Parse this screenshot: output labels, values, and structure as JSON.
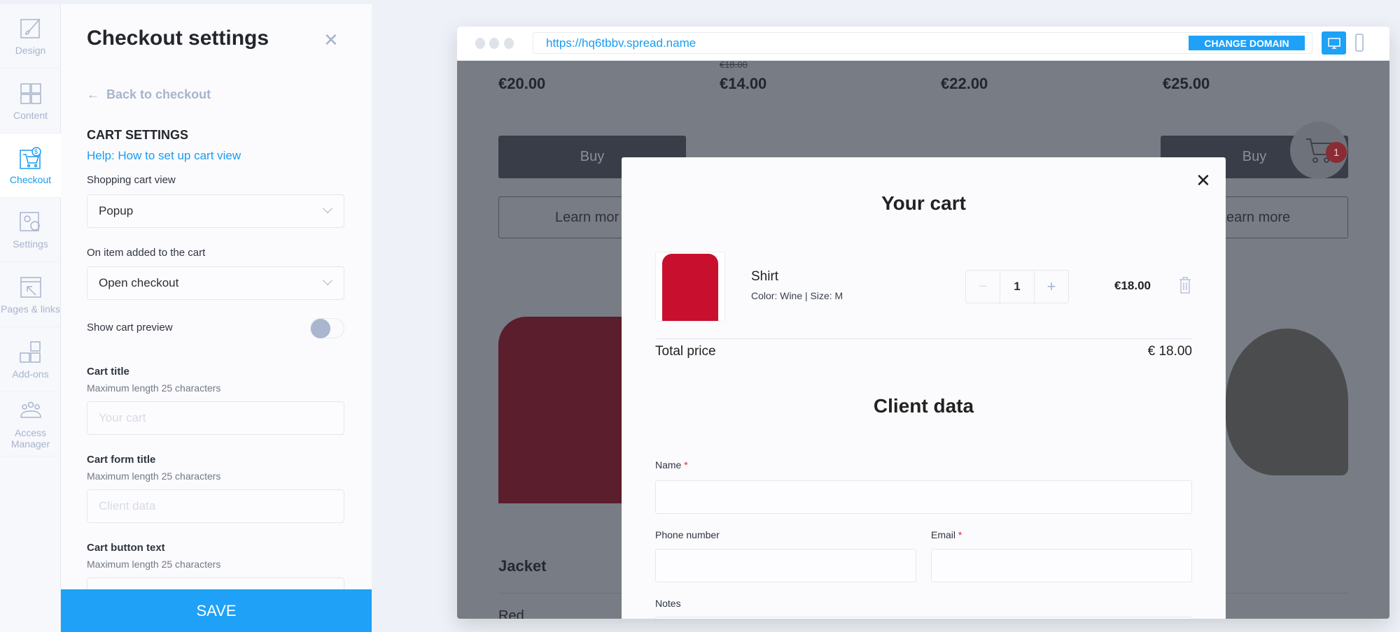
{
  "rail": [
    {
      "label": "Design",
      "icon": "brush-icon"
    },
    {
      "label": "Content",
      "icon": "grid-icon"
    },
    {
      "label": "Checkout",
      "icon": "cart-dollar-icon",
      "active": true
    },
    {
      "label": "Settings",
      "icon": "gears-icon"
    },
    {
      "label": "Pages & links",
      "icon": "pages-icon"
    },
    {
      "label": "Add-ons",
      "icon": "addons-icon"
    },
    {
      "label": "Access Manager",
      "icon": "users-icon"
    }
  ],
  "panel": {
    "title": "Checkout settings",
    "back": "Back to checkout",
    "section": "CART SETTINGS",
    "help": "Help: How to set up cart view",
    "cart_view_label": "Shopping cart view",
    "cart_view_value": "Popup",
    "on_add_label": "On item added to the cart",
    "on_add_value": "Open checkout",
    "preview_label": "Show cart preview",
    "preview_on": false,
    "cart_title_label": "Cart title",
    "cart_title_hint": "Maximum length 25 characters",
    "cart_title_placeholder": "Your cart",
    "form_title_label": "Cart form title",
    "form_title_hint": "Maximum length 25 characters",
    "form_title_placeholder": "Client data",
    "button_text_label": "Cart button text",
    "button_text_hint": "Maximum length 25 characters",
    "save": "SAVE"
  },
  "browser": {
    "url": "https://hq6tbbv.spread.name",
    "change_domain": "CHANGE DOMAIN"
  },
  "site": {
    "prices": [
      "€20.00",
      "€14.00",
      "€22.00",
      "€25.00"
    ],
    "old_price": "€18.00",
    "buy": "Buy",
    "learn": "Learn more",
    "learn_partial_left": "Learn mor",
    "learn_partial_right": "earn more",
    "product": "Jacket",
    "color": "Red",
    "cart_count": "1"
  },
  "modal": {
    "title": "Your cart",
    "item": {
      "name": "Shirt",
      "meta": "Color: Wine | Size: M",
      "qty": "1",
      "price": "€18.00"
    },
    "total_label": "Total price",
    "total_value": "€ 18.00",
    "form_title": "Client data",
    "name_label": "Name",
    "phone_label": "Phone number",
    "email_label": "Email",
    "notes_label": "Notes",
    "required": "*"
  },
  "colors": {
    "accent": "#1ea1f7",
    "overlay": "#787c84",
    "badge": "#c0333a"
  }
}
